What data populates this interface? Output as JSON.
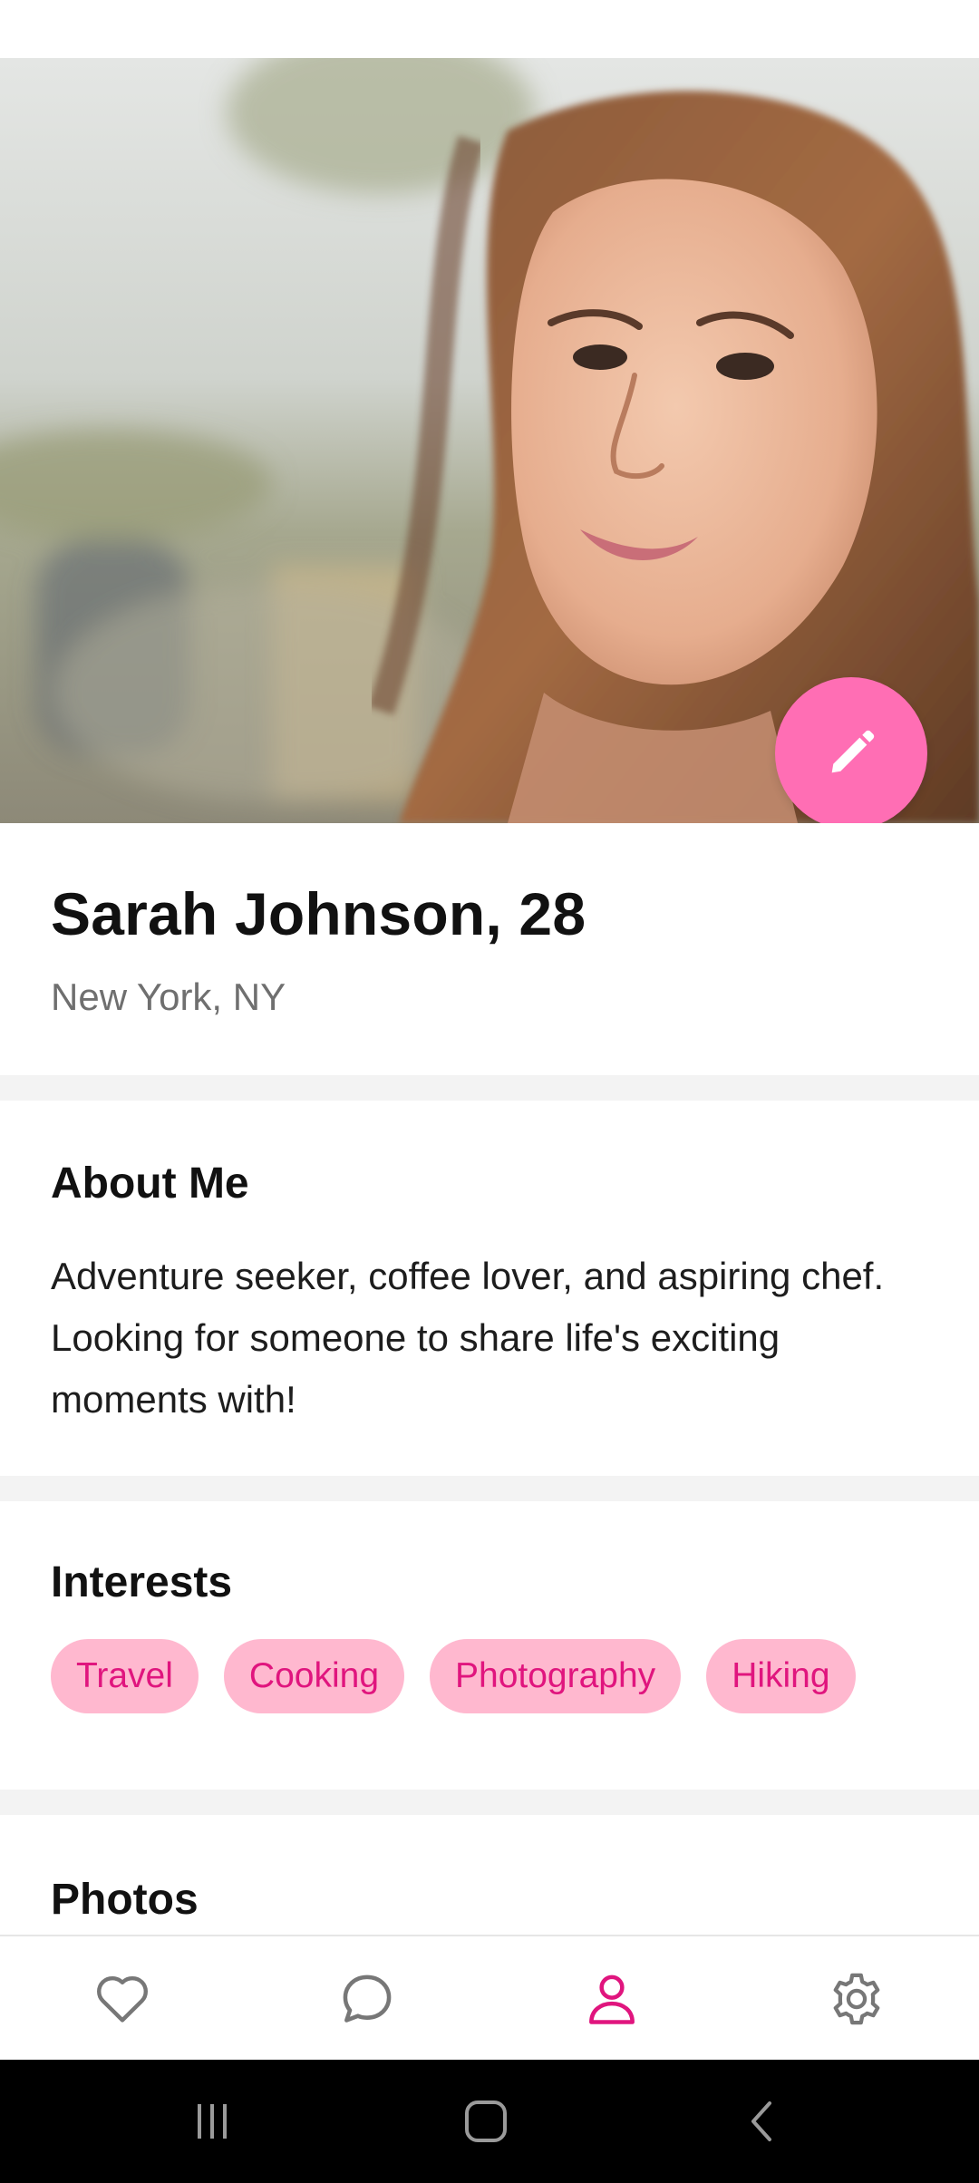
{
  "profile": {
    "name_age": "Sarah Johnson, 28",
    "location": "New York, NY"
  },
  "about": {
    "title": "About Me",
    "text": "Adventure seeker, coffee lover, and aspiring chef. Looking for someone to share life's exciting moments with!"
  },
  "interests": {
    "title": "Interests",
    "items": [
      "Travel",
      "Cooking",
      "Photography",
      "Hiking"
    ]
  },
  "photos": {
    "title": "Photos"
  },
  "icons": {
    "edit": "pencil-icon",
    "nav_likes": "heart-icon",
    "nav_messages": "chat-bubble-icon",
    "nav_profile": "person-icon",
    "nav_settings": "gear-icon",
    "sys_recents": "recents-icon",
    "sys_home": "home-icon",
    "sys_back": "back-icon"
  },
  "colors": {
    "accent": "#ff6eb4",
    "chip_background": "#ffb8cf",
    "chip_text": "#e0157e",
    "active_nav": "#e0157e",
    "inactive_nav": "#777777"
  }
}
